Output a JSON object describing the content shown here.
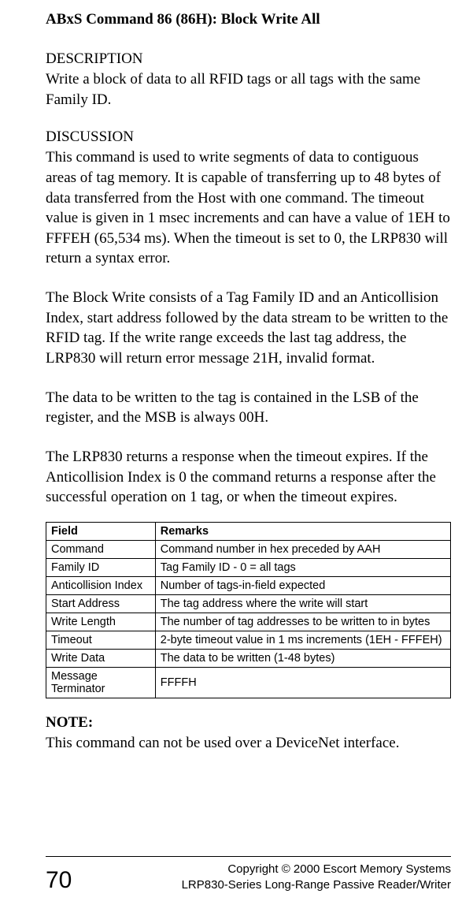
{
  "title": "ABxS Command 86 (86H): Block Write All",
  "desc_head": "DESCRIPTION",
  "desc_body": "Write a block of data to all RFID tags or all tags with the same Family ID.",
  "disc_head": "DISCUSSION",
  "disc_p1": "This command is used to write segments of data to contiguous areas of tag memory. It is capable of transferring up to 48 bytes of data transferred from the Host with one command.  The timeout value is given in 1 msec increments and can have a value of 1EH to FFFEH (65,534 ms). When the timeout is set to 0, the LRP830 will return a syntax error.",
  "disc_p2": "The Block Write consists of a Tag Family ID and an Anticollision Index, start address followed by the data stream to be written to the RFID tag. If the write range exceeds the last tag address, the LRP830 will return error message 21H, invalid format.",
  "disc_p3": "The data to be written to the tag is contained in the LSB of the register, and the MSB is always 00H.",
  "disc_p4": "The LRP830 returns a response when the timeout expires.   If the Anticollision Index is 0 the command returns a response after the successful operation on 1 tag, or when the timeout expires.",
  "table": {
    "head_field": "Field",
    "head_remarks": "Remarks",
    "rows": [
      {
        "field": "Command",
        "remarks": "Command number in hex preceded by AAH"
      },
      {
        "field": "Family ID",
        "remarks": "Tag Family ID - 0 = all tags"
      },
      {
        "field": "Anticollision Index",
        "remarks": "Number of tags-in-field expected"
      },
      {
        "field": "Start Address",
        "remarks": "The tag address where the write will start"
      },
      {
        "field": "Write Length",
        "remarks": "The number of tag addresses to be written to in bytes"
      },
      {
        "field": "Timeout",
        "remarks": "2-byte timeout value in 1 ms increments (1EH - FFFEH)"
      },
      {
        "field": "Write Data",
        "remarks": "The data to be written (1-48 bytes)"
      },
      {
        "field": "Message Terminator",
        "remarks": "FFFFH"
      }
    ]
  },
  "note_head": "NOTE:",
  "note_body": "This command can not be used over a DeviceNet interface.",
  "footer": {
    "page": "70",
    "line1": "Copyright © 2000 Escort Memory Systems",
    "line2": "LRP830-Series Long-Range Passive Reader/Writer"
  }
}
